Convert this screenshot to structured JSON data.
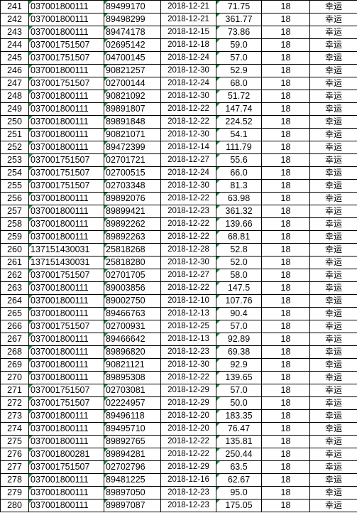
{
  "rows": [
    {
      "idx": "241",
      "account": "037001800111",
      "number": "89499170",
      "date": "2018-12-21",
      "amount": "71.75",
      "qty": "18",
      "tag": "幸运"
    },
    {
      "idx": "242",
      "account": "037001800111",
      "number": "89498299",
      "date": "2018-12-21",
      "amount": "361.77",
      "qty": "18",
      "tag": "幸运"
    },
    {
      "idx": "243",
      "account": "037001800111",
      "number": "89474178",
      "date": "2018-12-15",
      "amount": "73.86",
      "qty": "18",
      "tag": "幸运"
    },
    {
      "idx": "244",
      "account": "037001751507",
      "number": "02695142",
      "date": "2018-12-18",
      "amount": "59.0",
      "qty": "18",
      "tag": "幸运"
    },
    {
      "idx": "245",
      "account": "037001751507",
      "number": "04700145",
      "date": "2018-12-24",
      "amount": "57.0",
      "qty": "18",
      "tag": "幸运"
    },
    {
      "idx": "246",
      "account": "037001800111",
      "number": "90821257",
      "date": "2018-12-30",
      "amount": "52.9",
      "qty": "18",
      "tag": "幸运"
    },
    {
      "idx": "247",
      "account": "037001751507",
      "number": "02700144",
      "date": "2018-12-24",
      "amount": "68.0",
      "qty": "18",
      "tag": "幸运"
    },
    {
      "idx": "248",
      "account": "037001800111",
      "number": "90821092",
      "date": "2018-12-30",
      "amount": "51.72",
      "qty": "18",
      "tag": "幸运"
    },
    {
      "idx": "249",
      "account": "037001800111",
      "number": "89891807",
      "date": "2018-12-22",
      "amount": "147.74",
      "qty": "18",
      "tag": "幸运"
    },
    {
      "idx": "250",
      "account": "037001800111",
      "number": "89891848",
      "date": "2018-12-22",
      "amount": "224.52",
      "qty": "18",
      "tag": "幸运"
    },
    {
      "idx": "251",
      "account": "037001800111",
      "number": "90821071",
      "date": "2018-12-30",
      "amount": "54.1",
      "qty": "18",
      "tag": "幸运"
    },
    {
      "idx": "252",
      "account": "037001800111",
      "number": "89472399",
      "date": "2018-12-14",
      "amount": "111.79",
      "qty": "18",
      "tag": "幸运"
    },
    {
      "idx": "253",
      "account": "037001751507",
      "number": "02701721",
      "date": "2018-12-27",
      "amount": "55.6",
      "qty": "18",
      "tag": "幸运"
    },
    {
      "idx": "254",
      "account": "037001751507",
      "number": "02700515",
      "date": "2018-12-24",
      "amount": "66.0",
      "qty": "18",
      "tag": "幸运"
    },
    {
      "idx": "255",
      "account": "037001751507",
      "number": "02703348",
      "date": "2018-12-30",
      "amount": "81.3",
      "qty": "18",
      "tag": "幸运"
    },
    {
      "idx": "256",
      "account": "037001800111",
      "number": "89892076",
      "date": "2018-12-22",
      "amount": "63.98",
      "qty": "18",
      "tag": "幸运"
    },
    {
      "idx": "257",
      "account": "037001800111",
      "number": "89899421",
      "date": "2018-12-23",
      "amount": "361.32",
      "qty": "18",
      "tag": "幸运"
    },
    {
      "idx": "258",
      "account": "037001800111",
      "number": "89892262",
      "date": "2018-12-22",
      "amount": "139.66",
      "qty": "18",
      "tag": "幸运"
    },
    {
      "idx": "259",
      "account": "037001800111",
      "number": "89892263",
      "date": "2018-12-22",
      "amount": "68.81",
      "qty": "18",
      "tag": "幸运"
    },
    {
      "idx": "260",
      "account": "137151430031",
      "number": "25818268",
      "date": "2018-12-28",
      "amount": "52.8",
      "qty": "18",
      "tag": "幸运"
    },
    {
      "idx": "261",
      "account": "137151430031",
      "number": "25818280",
      "date": "2018-12-30",
      "amount": "52.0",
      "qty": "18",
      "tag": "幸运"
    },
    {
      "idx": "262",
      "account": "037001751507",
      "number": "02701705",
      "date": "2018-12-27",
      "amount": "58.0",
      "qty": "18",
      "tag": "幸运"
    },
    {
      "idx": "263",
      "account": "037001800111",
      "number": "89003856",
      "date": "2018-12-22",
      "amount": "147.5",
      "qty": "18",
      "tag": "幸运"
    },
    {
      "idx": "264",
      "account": "037001800111",
      "number": "89002750",
      "date": "2018-12-10",
      "amount": "107.76",
      "qty": "18",
      "tag": "幸运"
    },
    {
      "idx": "265",
      "account": "037001800111",
      "number": "89466763",
      "date": "2018-12-13",
      "amount": "90.4",
      "qty": "18",
      "tag": "幸运"
    },
    {
      "idx": "266",
      "account": "037001751507",
      "number": "02700931",
      "date": "2018-12-25",
      "amount": "57.0",
      "qty": "18",
      "tag": "幸运"
    },
    {
      "idx": "267",
      "account": "037001800111",
      "number": "89466642",
      "date": "2018-12-13",
      "amount": "92.89",
      "qty": "18",
      "tag": "幸运"
    },
    {
      "idx": "268",
      "account": "037001800111",
      "number": "89896820",
      "date": "2018-12-23",
      "amount": "69.38",
      "qty": "18",
      "tag": "幸运"
    },
    {
      "idx": "269",
      "account": "037001800111",
      "number": "90821121",
      "date": "2018-12-30",
      "amount": "92.9",
      "qty": "18",
      "tag": "幸运"
    },
    {
      "idx": "270",
      "account": "037001800111",
      "number": "89895308",
      "date": "2018-12-22",
      "amount": "139.65",
      "qty": "18",
      "tag": "幸运"
    },
    {
      "idx": "271",
      "account": "037001751507",
      "number": "02703081",
      "date": "2018-12-29",
      "amount": "57.0",
      "qty": "18",
      "tag": "幸运"
    },
    {
      "idx": "272",
      "account": "037001751507",
      "number": "02224957",
      "date": "2018-12-29",
      "amount": "50.0",
      "qty": "18",
      "tag": "幸运"
    },
    {
      "idx": "273",
      "account": "037001800111",
      "number": "89496118",
      "date": "2018-12-20",
      "amount": "183.35",
      "qty": "18",
      "tag": "幸运"
    },
    {
      "idx": "274",
      "account": "037001800111",
      "number": "89495710",
      "date": "2018-12-20",
      "amount": "76.47",
      "qty": "18",
      "tag": "幸运"
    },
    {
      "idx": "275",
      "account": "037001800111",
      "number": "89892765",
      "date": "2018-12-22",
      "amount": "135.81",
      "qty": "18",
      "tag": "幸运"
    },
    {
      "idx": "276",
      "account": "037001800281",
      "number": "89894281",
      "date": "2018-12-22",
      "amount": "250.44",
      "qty": "18",
      "tag": "幸运"
    },
    {
      "idx": "277",
      "account": "037001751507",
      "number": "02702796",
      "date": "2018-12-29",
      "amount": "63.5",
      "qty": "18",
      "tag": "幸运"
    },
    {
      "idx": "278",
      "account": "037001800111",
      "number": "89481225",
      "date": "2018-12-16",
      "amount": "62.67",
      "qty": "18",
      "tag": "幸运"
    },
    {
      "idx": "279",
      "account": "037001800111",
      "number": "89897050",
      "date": "2018-12-23",
      "amount": "95.0",
      "qty": "18",
      "tag": "幸运"
    },
    {
      "idx": "280",
      "account": "037001800111",
      "number": "89897087",
      "date": "2018-12-23",
      "amount": "175.05",
      "qty": "18",
      "tag": "幸运"
    }
  ]
}
